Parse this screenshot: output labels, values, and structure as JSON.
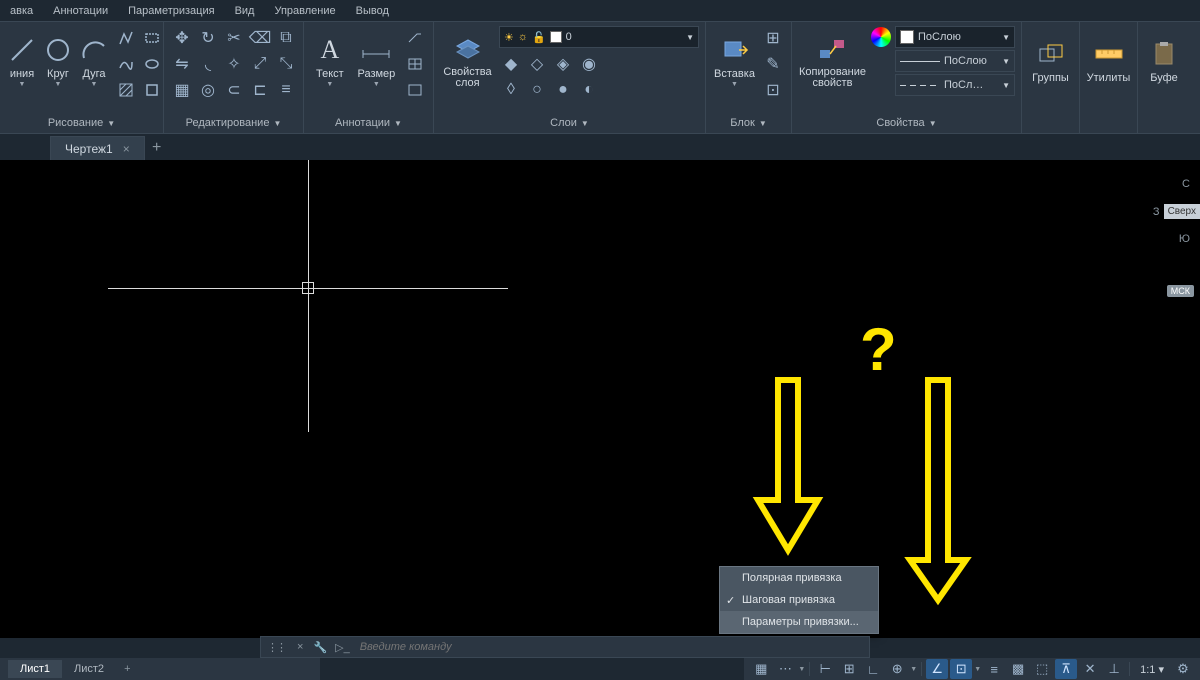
{
  "menu": [
    "авка",
    "Аннотации",
    "Параметризация",
    "Вид",
    "Управление",
    "Вывод"
  ],
  "panels": {
    "draw": {
      "label": "Рисование",
      "btns": {
        "line": "иния",
        "circle": "Круг",
        "arc": "Дуга"
      }
    },
    "edit": {
      "label": "Редактирование"
    },
    "annot": {
      "label": "Аннотации",
      "btns": {
        "text": "Текст",
        "dim": "Размер"
      }
    },
    "layers": {
      "label": "Слои",
      "btn": "Свойства\nслоя",
      "sel": "0"
    },
    "block": {
      "label": "Блок",
      "btn": "Вставка"
    },
    "props": {
      "label": "Свойства",
      "btn": "Копирование\nсвойств",
      "bylayer": "ПоСлою",
      "byl2": "ПоСлою",
      "byl3": "ПоСл…"
    },
    "groups": {
      "label": "Группы"
    },
    "utils": {
      "label": "Утилиты"
    },
    "clip": {
      "label": "Буфе"
    }
  },
  "docTab": "Чертеж1",
  "viewcube": {
    "z": "З",
    "face": "Сверх",
    "s": "Ю",
    "n": "С",
    "badge": "МСК"
  },
  "popup": {
    "i1": "Полярная привязка",
    "i2": "Шаговая привязка",
    "i3": "Параметры привязки..."
  },
  "cmd": {
    "placeholder": "Введите команду"
  },
  "sheets": [
    "Лист1",
    "Лист2"
  ],
  "scale": "1:1"
}
